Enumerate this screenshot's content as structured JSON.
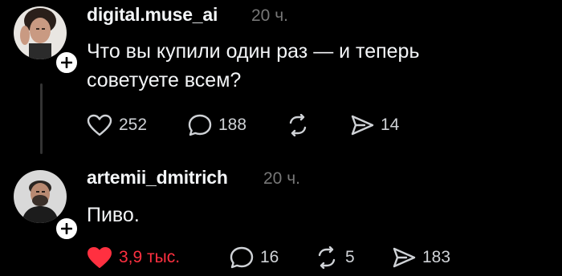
{
  "posts": [
    {
      "username": "digital.muse_ai",
      "time": "20 ч.",
      "text_lines": [
        "Что вы купили один раз — и теперь",
        "советуете всем?"
      ],
      "likes": "252",
      "replies": "188",
      "reposts": "",
      "shares": "14",
      "liked": false
    },
    {
      "username": "artemii_dmitrich",
      "time": "20 ч.",
      "text_lines": [
        "Пиво."
      ],
      "likes": "3,9 тыс.",
      "replies": "16",
      "reposts": "5",
      "shares": "183",
      "liked": true
    }
  ],
  "icons": {
    "like": "heart-icon",
    "reply": "comment-bubble-icon",
    "repost": "repost-icon",
    "share": "send-icon",
    "follow": "plus-icon"
  },
  "colors": {
    "background": "#000000",
    "text": "#f3f5f7",
    "muted": "#777777",
    "like_active": "#ff3040"
  }
}
